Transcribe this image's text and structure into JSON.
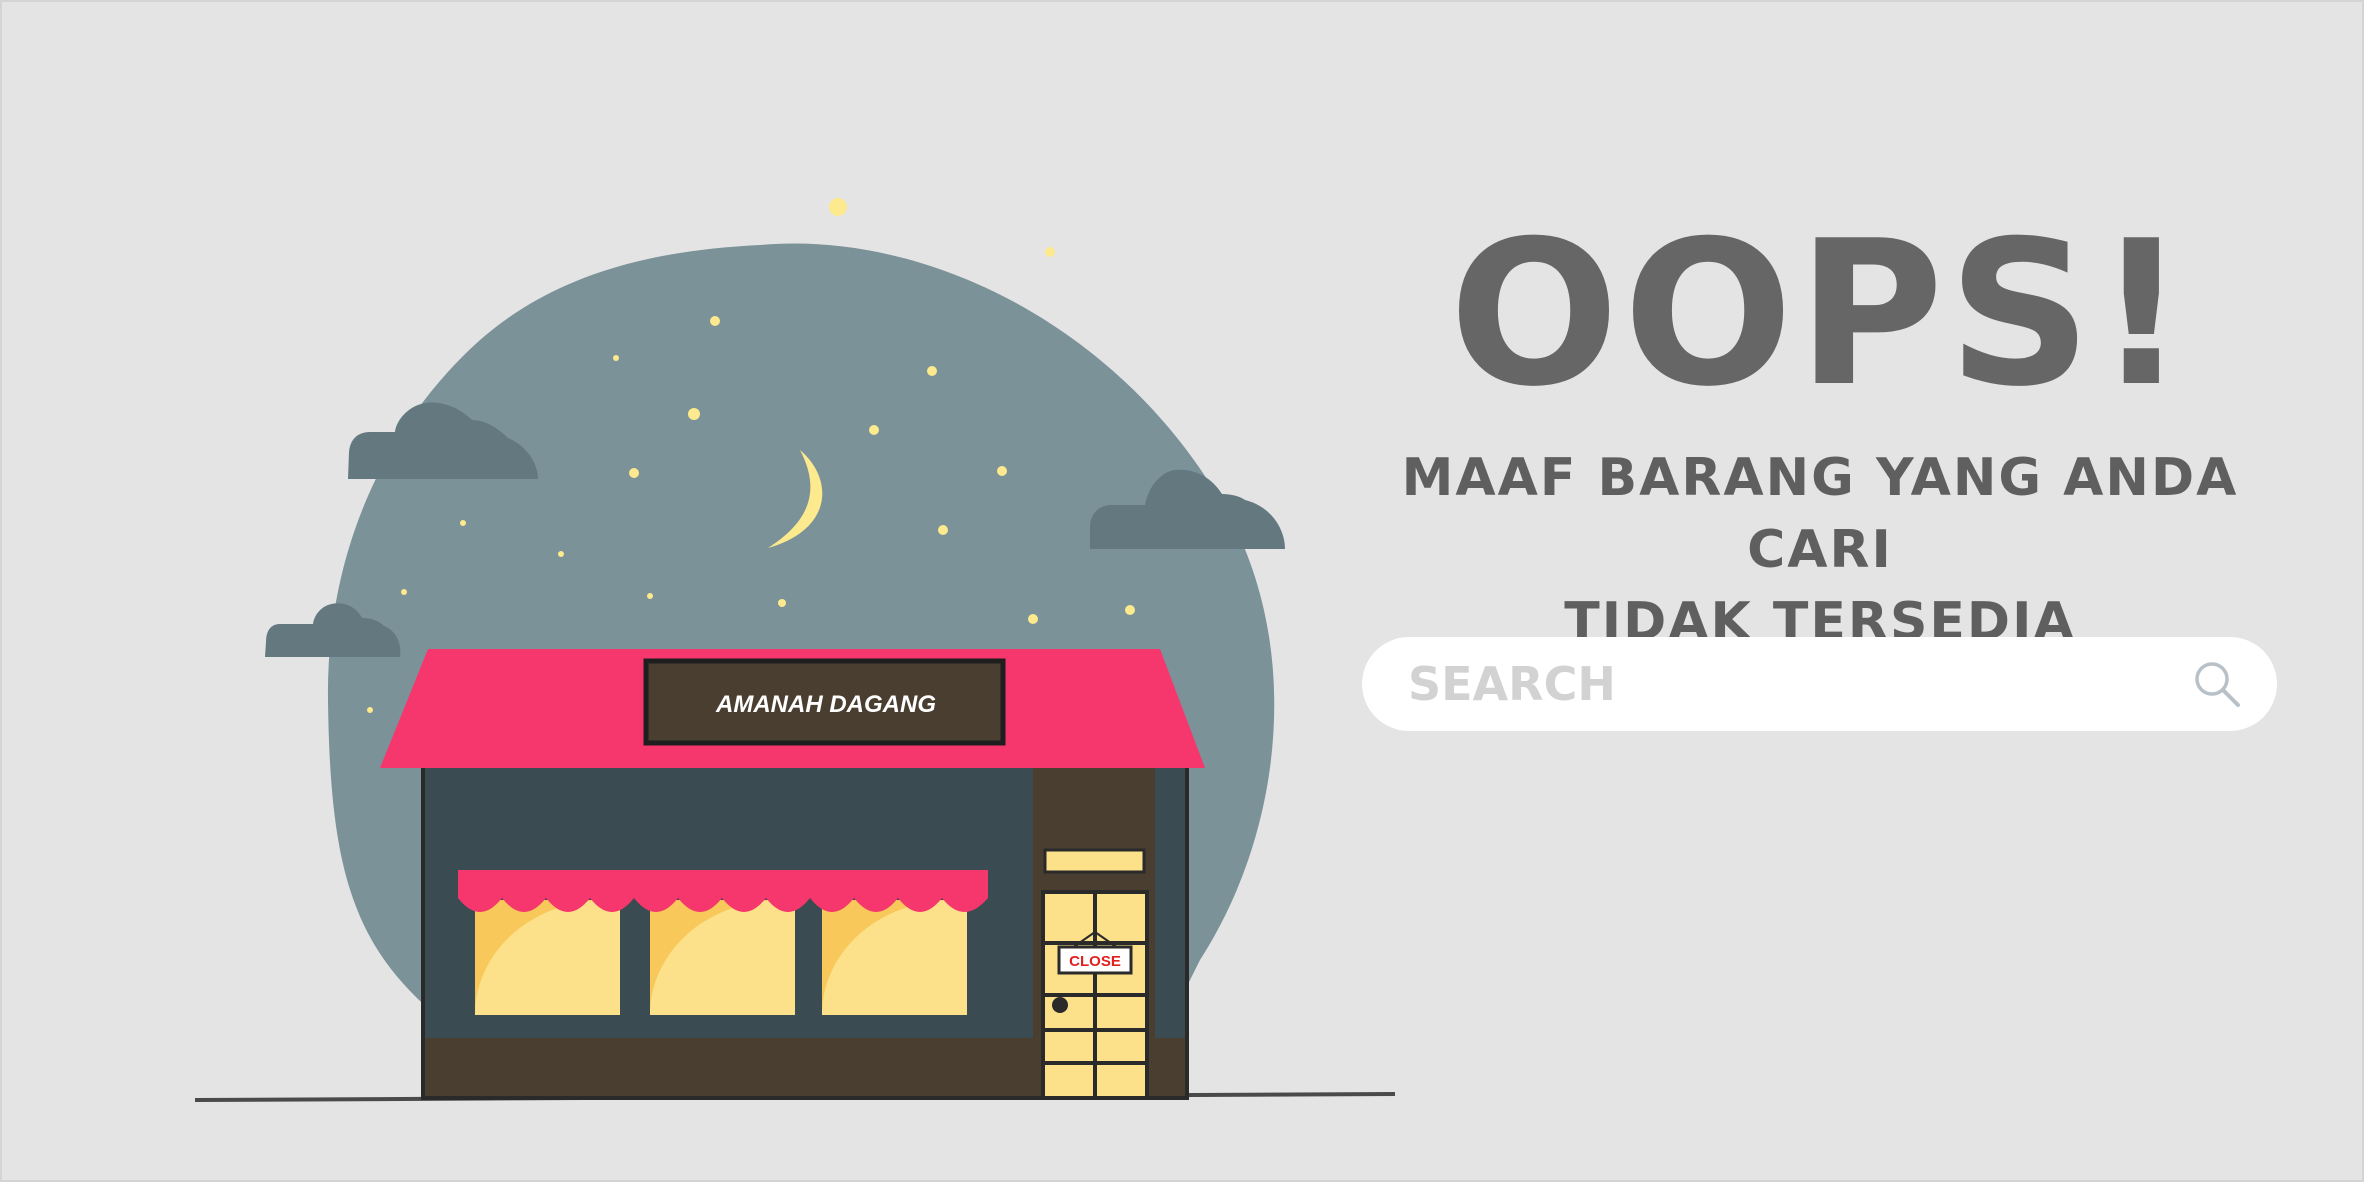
{
  "store": {
    "sign_text": "AMANAH DAGANG",
    "door_sign_text": "CLOSE"
  },
  "error": {
    "title": "OOPS!",
    "message_line1": "MAAF BARANG YANG ANDA CARI",
    "message_line2": "TIDAK TERSEDIA"
  },
  "search": {
    "placeholder": "SEARCH",
    "icon": "search-icon"
  },
  "colors": {
    "background": "#e4e4e4",
    "night_sky": "#7b9299",
    "cloud": "#647880",
    "awning": "#f6376d",
    "storefront": "#3b4b52",
    "wall": "#4a3e31",
    "window_light": "#fde08a",
    "moon": "#fde98e",
    "text": "#666666"
  }
}
